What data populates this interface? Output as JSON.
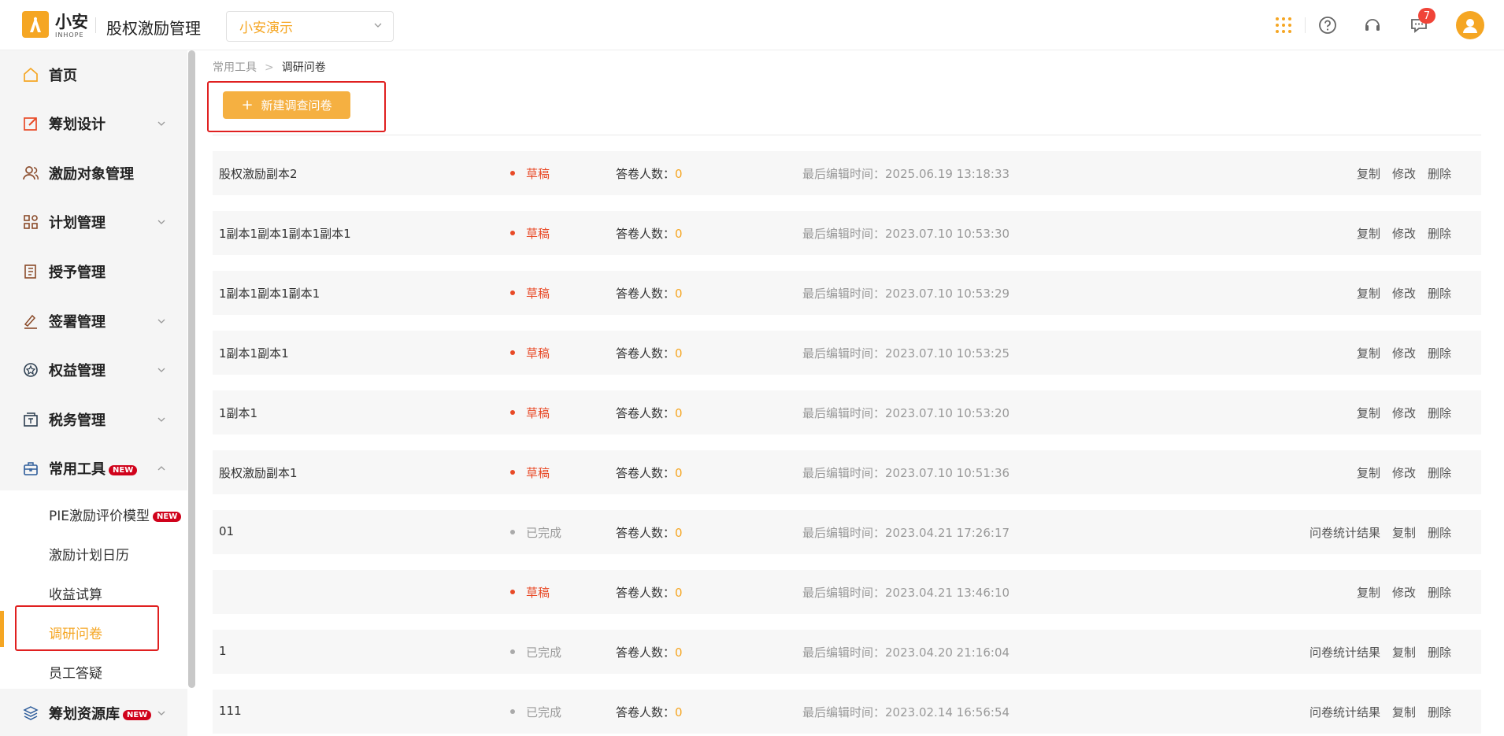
{
  "header": {
    "logo_text": "小安",
    "logo_sub": "INHOPE",
    "app_title": "股权激励管理",
    "tenant": "小安演示",
    "notification_count": "7",
    "accent": "#f5a623"
  },
  "sidebar": {
    "items": [
      {
        "label": "首页",
        "icon": "home-icon"
      },
      {
        "label": "筹划设计",
        "icon": "edit-icon"
      },
      {
        "label": "激励对象管理",
        "icon": "users-icon"
      },
      {
        "label": "计划管理",
        "icon": "grid-icon"
      },
      {
        "label": "授予管理",
        "icon": "book-icon"
      },
      {
        "label": "签署管理",
        "icon": "sign-icon"
      },
      {
        "label": "权益管理",
        "icon": "badge-icon"
      },
      {
        "label": "税务管理",
        "icon": "tax-icon"
      },
      {
        "label": "常用工具",
        "icon": "toolbox-icon"
      },
      {
        "label": "筹划资源库",
        "icon": "layers-icon"
      }
    ],
    "new_tag": "NEW",
    "sub_items": [
      {
        "label": "PIE激励评价模型"
      },
      {
        "label": "激励计划日历"
      },
      {
        "label": "收益试算"
      },
      {
        "label": "调研问卷"
      },
      {
        "label": "员工答疑"
      }
    ]
  },
  "breadcrumb": {
    "parent": "常用工具",
    "current": "调研问卷"
  },
  "new_button_label": "新建调查问卷",
  "list": {
    "count_label": "答卷人数：",
    "time_label": "最后编辑时间：",
    "rows": [
      {
        "name": "股权激励副本2",
        "status": "草稿",
        "count": "0",
        "time": "2025.06.19 13:18:33",
        "a1": "复制",
        "a2": "修改",
        "a3": "删除"
      },
      {
        "name": "1副本1副本1副本1副本1",
        "status": "草稿",
        "count": "0",
        "time": "2023.07.10 10:53:30",
        "a1": "复制",
        "a2": "修改",
        "a3": "删除"
      },
      {
        "name": "1副本1副本1副本1",
        "status": "草稿",
        "count": "0",
        "time": "2023.07.10 10:53:29",
        "a1": "复制",
        "a2": "修改",
        "a3": "删除"
      },
      {
        "name": "1副本1副本1",
        "status": "草稿",
        "count": "0",
        "time": "2023.07.10 10:53:25",
        "a1": "复制",
        "a2": "修改",
        "a3": "删除"
      },
      {
        "name": "1副本1",
        "status": "草稿",
        "count": "0",
        "time": "2023.07.10 10:53:20",
        "a1": "复制",
        "a2": "修改",
        "a3": "删除"
      },
      {
        "name": "股权激励副本1",
        "status": "草稿",
        "count": "0",
        "time": "2023.07.10 10:51:36",
        "a1": "复制",
        "a2": "修改",
        "a3": "删除"
      },
      {
        "name": "01",
        "status": "已完成",
        "count": "0",
        "time": "2023.04.21 17:26:17",
        "a1": "问卷统计结果",
        "a2": "复制",
        "a3": "删除"
      },
      {
        "name": "",
        "status": "草稿",
        "count": "0",
        "time": "2023.04.21 13:46:10",
        "a1": "复制",
        "a2": "修改",
        "a3": "删除"
      },
      {
        "name": "1",
        "status": "已完成",
        "count": "0",
        "time": "2023.04.20 21:16:04",
        "a1": "问卷统计结果",
        "a2": "复制",
        "a3": "删除"
      },
      {
        "name": "111",
        "status": "已完成",
        "count": "0",
        "time": "2023.02.14 16:56:54",
        "a1": "问卷统计结果",
        "a2": "复制",
        "a3": "删除"
      }
    ]
  }
}
